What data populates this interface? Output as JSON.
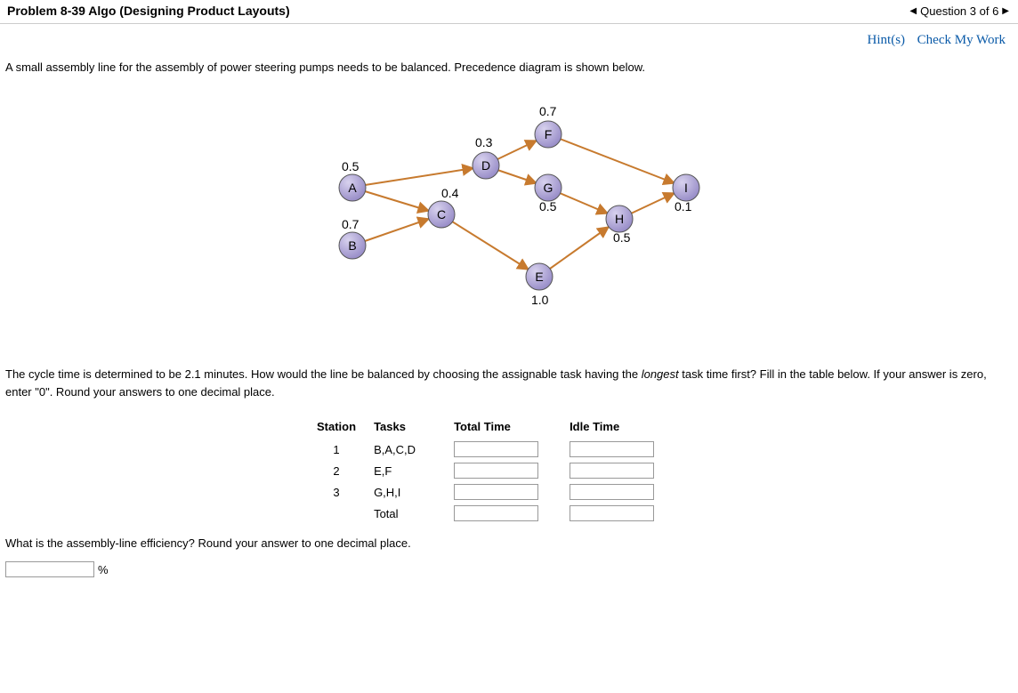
{
  "header": {
    "title": "Problem 8-39 Algo (Designing Product Layouts)",
    "nav_label": "Question 3 of 6"
  },
  "links": {
    "hints": "Hint(s)",
    "check": "Check My Work"
  },
  "intro": "A small assembly line for the assembly of power steering pumps needs to be balanced. Precedence diagram is shown below.",
  "question_pre": "The cycle time is determined to be 2.1 minutes. How would the line be balanced by choosing the assignable task having the ",
  "question_italic": "longest",
  "question_post": " task time first? Fill in the table below. If your answer is zero, enter \"0\". Round your answers to one decimal place.",
  "table": {
    "h_station": "Station",
    "h_tasks": "Tasks",
    "h_total": "Total Time",
    "h_idle": "Idle Time",
    "rows": [
      {
        "station": "1",
        "tasks": "B,A,C,D"
      },
      {
        "station": "2",
        "tasks": "E,F"
      },
      {
        "station": "3",
        "tasks": "G,H,I"
      },
      {
        "station": "",
        "tasks": "Total"
      }
    ]
  },
  "eff_q": "What is the assembly-line efficiency? Round your answer to one decimal place.",
  "pct": "%",
  "diagram": {
    "nodes": {
      "A": {
        "label": "A",
        "time": "0.5"
      },
      "B": {
        "label": "B",
        "time": "0.7"
      },
      "C": {
        "label": "C",
        "time": "0.4"
      },
      "D": {
        "label": "D",
        "time": "0.3"
      },
      "E": {
        "label": "E",
        "time": "1.0"
      },
      "F": {
        "label": "F",
        "time": "0.7"
      },
      "G": {
        "label": "G",
        "time": "0.5"
      },
      "H": {
        "label": "H",
        "time": "0.5"
      },
      "I": {
        "label": "I",
        "time": "0.1"
      }
    }
  },
  "chart_data": {
    "type": "precedence-diagram",
    "tasks": [
      {
        "id": "A",
        "time": 0.5,
        "predecessors": []
      },
      {
        "id": "B",
        "time": 0.7,
        "predecessors": []
      },
      {
        "id": "C",
        "time": 0.4,
        "predecessors": [
          "A",
          "B"
        ]
      },
      {
        "id": "D",
        "time": 0.3,
        "predecessors": [
          "A"
        ]
      },
      {
        "id": "E",
        "time": 1.0,
        "predecessors": [
          "C"
        ]
      },
      {
        "id": "F",
        "time": 0.7,
        "predecessors": [
          "D"
        ]
      },
      {
        "id": "G",
        "time": 0.5,
        "predecessors": [
          "D"
        ]
      },
      {
        "id": "H",
        "time": 0.5,
        "predecessors": [
          "E",
          "G"
        ]
      },
      {
        "id": "I",
        "time": 0.1,
        "predecessors": [
          "F",
          "H"
        ]
      }
    ],
    "cycle_time": 2.1
  }
}
